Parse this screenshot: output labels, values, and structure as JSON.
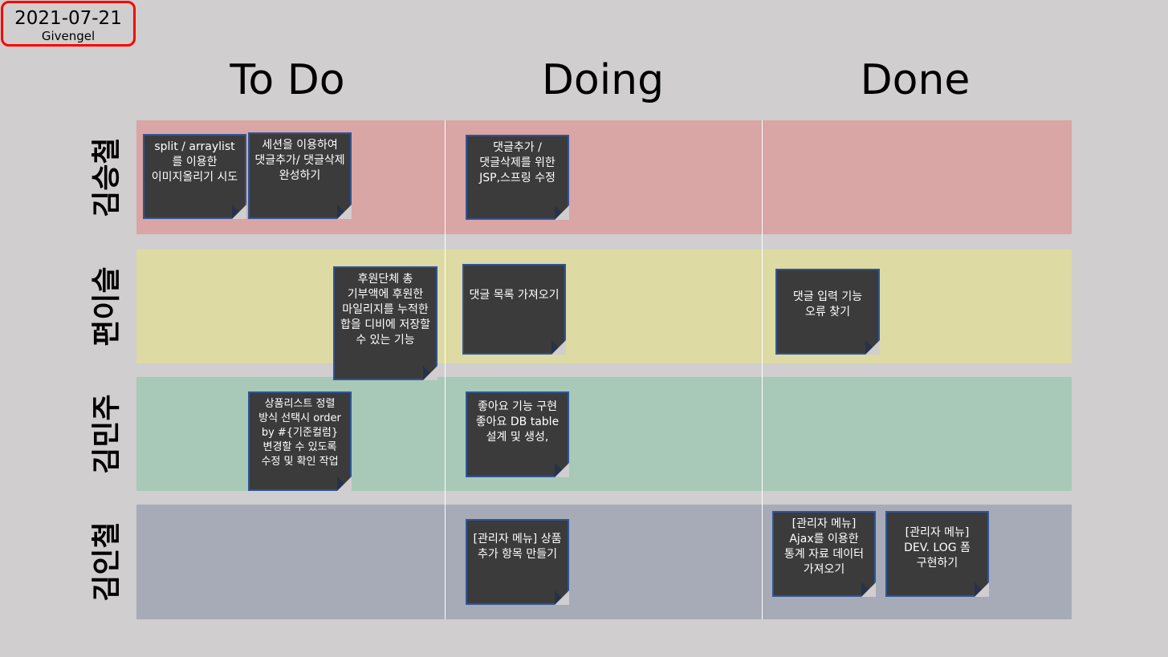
{
  "header": {
    "date": "2021-07-21",
    "team": "Givengel"
  },
  "columns": {
    "todo": "To Do",
    "doing": "Doing",
    "done": "Done"
  },
  "lanes": [
    {
      "name": "김승철",
      "color": "#d9a5a5"
    },
    {
      "name": "편이슬",
      "color": "#dddaa3"
    },
    {
      "name": "김민주",
      "color": "#a8c8b8"
    },
    {
      "name": "김인철",
      "color": "#a6abb7"
    }
  ],
  "notes": {
    "n1": "split / arraylist 를 이용한 이미지올리기 시도",
    "n2": "세션을 이용하여 댓글추가/ 댓글삭제 완성하기",
    "n3": "댓글추가 / 댓글삭제를 위한 JSP,스프링 수정",
    "n4": "후원단체 총 기부액에 후원한 마일리지를 누적한 합을 디비에 저장할 수 있는 기능",
    "n5": "댓글 목록 가져오기",
    "n6": "댓글 입력 기능 오류 찾기",
    "n7": "상품리스트 정렬 방식 선택시 order by #{기준컬럼} 변경할 수 있도록 수정 및 확인 작업",
    "n8": "좋아요 기능 구현 좋아요 DB table 설계 및 생성,",
    "n9": "[관리자 메뉴] 상품 추가 항목 만들기",
    "n10": "[관리자 메뉴] Ajax를 이용한 통계 자료 데이터 가져오기",
    "n11": "[관리자 메뉴] DEV. LOG 폼 구현하기"
  }
}
